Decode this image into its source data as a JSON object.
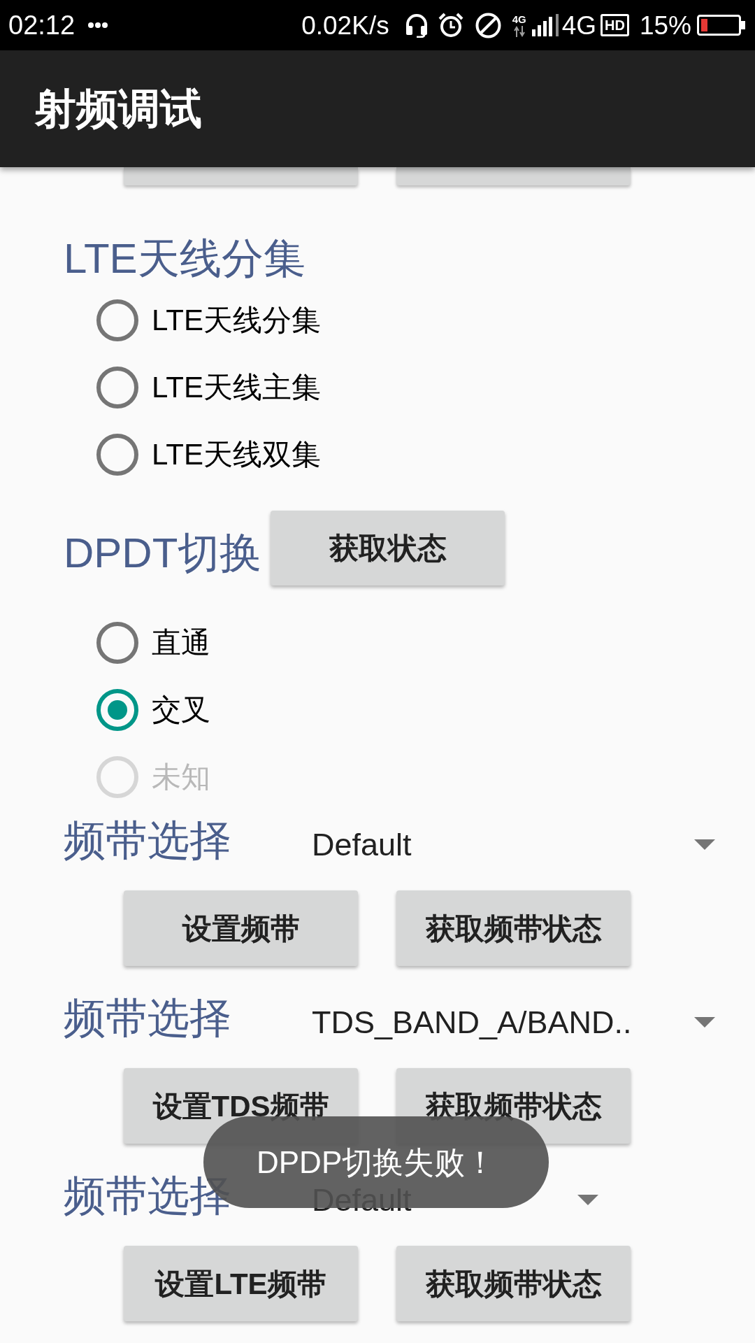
{
  "status_bar": {
    "time": "02:12",
    "net_speed": "0.02K/s",
    "network_small": "4G",
    "network": "4G",
    "hd": "HD",
    "battery": "15%"
  },
  "app_bar": {
    "title": "射频调试"
  },
  "scrolled_buttons": [
    {
      "kind": "edge"
    },
    {
      "kind": "edge"
    }
  ],
  "sections": [
    {
      "kind": "radio_group",
      "heading": "LTE天线分集",
      "options": [
        {
          "label": "LTE天线分集",
          "selected": false,
          "disabled": false
        },
        {
          "label": "LTE天线主集",
          "selected": false,
          "disabled": false
        },
        {
          "label": "LTE天线双集",
          "selected": false,
          "disabled": false
        }
      ]
    },
    {
      "kind": "radio_group",
      "heading": "DPDT切换",
      "button": "获取状态",
      "options": [
        {
          "label": "直通",
          "selected": false,
          "disabled": false
        },
        {
          "label": "交叉",
          "selected": true,
          "disabled": false
        },
        {
          "label": "未知",
          "selected": false,
          "disabled": true
        }
      ]
    },
    {
      "kind": "band",
      "heading": "频带选择",
      "spinner": {
        "value": "Default"
      },
      "buttons": [
        "设置频带",
        "获取频带状态"
      ]
    },
    {
      "kind": "band",
      "heading": "频带选择",
      "spinner": {
        "value": "TDS_BAND_A/BAND.."
      },
      "buttons": [
        "设置TDS频带",
        "获取频带状态"
      ]
    },
    {
      "kind": "band",
      "heading": "频带选择",
      "spinner": {
        "value": "Default"
      },
      "buttons": [
        "设置LTE频带",
        "获取频带状态"
      ]
    }
  ],
  "toast": {
    "message": "DPDP切换失败！"
  }
}
